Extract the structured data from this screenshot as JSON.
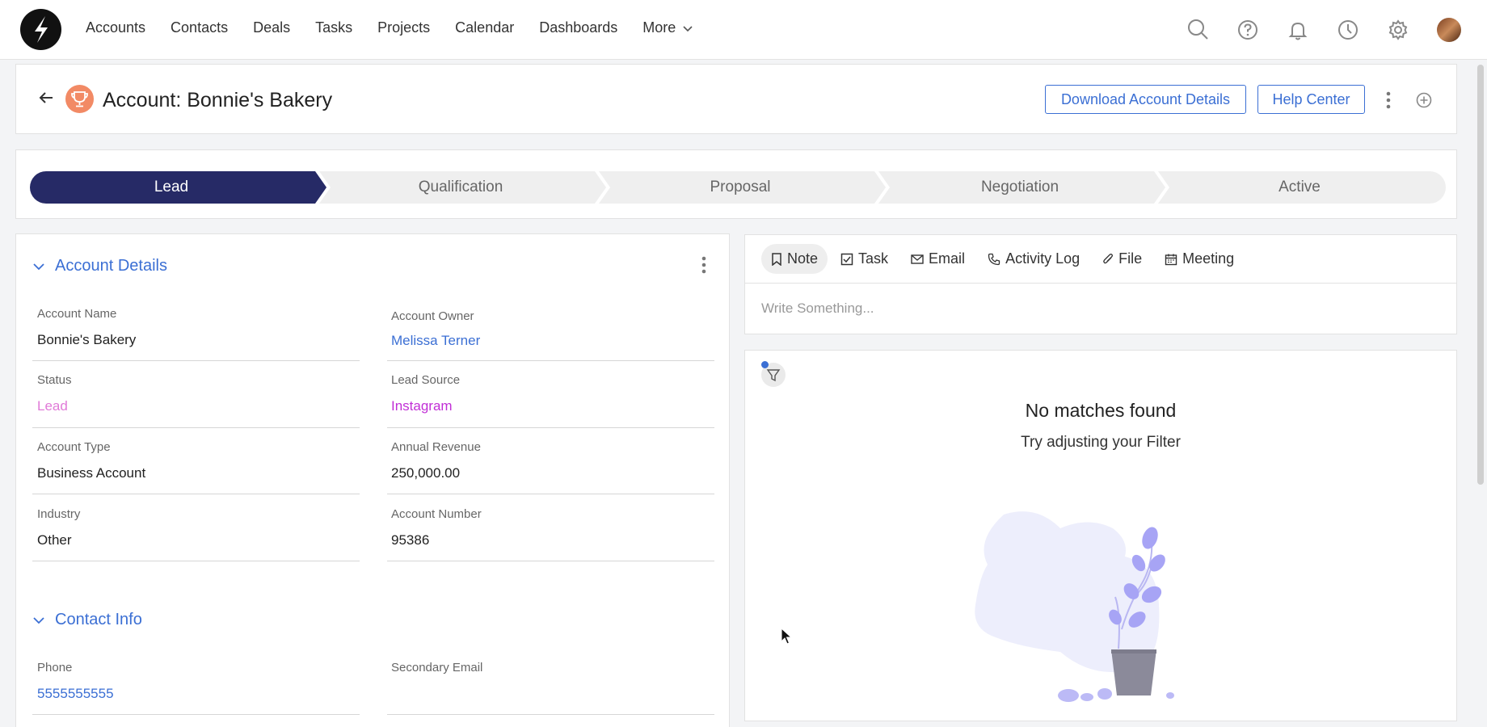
{
  "nav": {
    "items": [
      "Accounts",
      "Contacts",
      "Deals",
      "Tasks",
      "Projects",
      "Calendar",
      "Dashboards"
    ],
    "more_label": "More"
  },
  "header": {
    "title": "Account: Bonnie's Bakery",
    "download_button": "Download Account Details",
    "help_button": "Help Center"
  },
  "pipeline": {
    "stages": [
      "Lead",
      "Qualification",
      "Proposal",
      "Negotiation",
      "Active"
    ],
    "active_stage": "Lead",
    "active_color": "#262a66"
  },
  "account_details": {
    "section_title": "Account Details",
    "fields": {
      "account_name_label": "Account Name",
      "account_name": "Bonnie's Bakery",
      "account_owner_label": "Account Owner",
      "account_owner": "Melissa Terner",
      "status_label": "Status",
      "status": "Lead",
      "lead_source_label": "Lead Source",
      "lead_source": "Instagram",
      "account_type_label": "Account Type",
      "account_type": "Business Account",
      "annual_revenue_label": "Annual Revenue",
      "annual_revenue": "250,000.00",
      "industry_label": "Industry",
      "industry": "Other",
      "account_number_label": "Account Number",
      "account_number": "95386"
    }
  },
  "contact_info": {
    "section_title": "Contact Info",
    "phone_label": "Phone",
    "phone": "5555555555",
    "secondary_email_label": "Secondary Email",
    "secondary_email": ""
  },
  "composer": {
    "tabs": [
      "Note",
      "Task",
      "Email",
      "Activity Log",
      "File",
      "Meeting"
    ],
    "placeholder": "Write Something..."
  },
  "activity": {
    "empty_title": "No matches found",
    "empty_subtitle": "Try adjusting your Filter"
  },
  "colors": {
    "link_blue": "#3b6fd4",
    "status_pink": "#e07ad8",
    "source_magenta": "#c12fd6"
  }
}
